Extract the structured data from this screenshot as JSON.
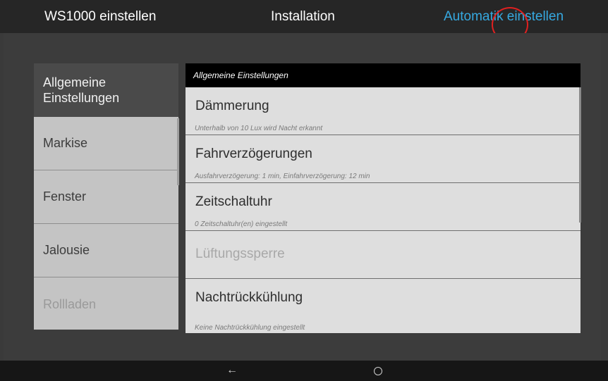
{
  "header": {
    "left_title": "WS1000 einstellen",
    "center_title": "Installation",
    "right_action": "Automatik einstellen",
    "accent_color": "#36a9e1"
  },
  "sidebar": {
    "items": [
      {
        "label": "Allgemeine Einstellungen",
        "state": "selected"
      },
      {
        "label": "Markise",
        "state": "normal"
      },
      {
        "label": "Fenster",
        "state": "normal"
      },
      {
        "label": "Jalousie",
        "state": "normal"
      },
      {
        "label": "Rollladen",
        "state": "disabled"
      }
    ]
  },
  "panel": {
    "header": "Allgemeine Einstellungen",
    "rows": [
      {
        "title": "Dämmerung",
        "subtitle": "Unterhalb von  10 Lux wird Nacht erkannt"
      },
      {
        "title": "Fahrverzögerungen",
        "subtitle": "Ausfahrverzögerung: 1 min, Einfahrverzögerung: 12 min"
      },
      {
        "title": "Zeitschaltuhr",
        "subtitle": "0 Zeitschaltuhr(en) eingestellt"
      },
      {
        "title": "Lüftungssperre",
        "subtitle": "",
        "state": "disabled"
      },
      {
        "title": "Nachtrückkühlung",
        "subtitle": "Keine Nachtrückkühlung eingestellt"
      }
    ]
  },
  "navbar": {
    "back_icon": "←",
    "home_icon": "home-circle"
  }
}
